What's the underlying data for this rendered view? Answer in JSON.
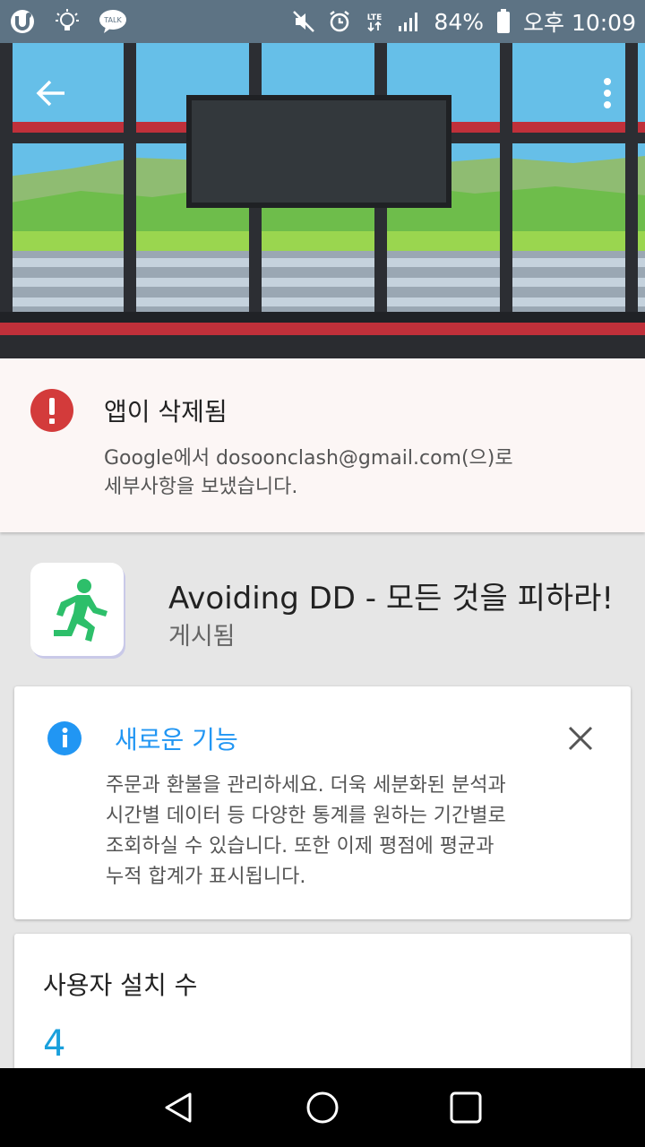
{
  "status_bar": {
    "battery": "84%",
    "time": "오후 10:09",
    "lte": "LTE",
    "kakao": "TALK",
    "icons": [
      "u-plus-icon",
      "lightbulb-icon",
      "kakaotalk-icon",
      "mute-icon",
      "alarm-icon",
      "lte-icon",
      "signal-icon",
      "battery-icon"
    ]
  },
  "header": {
    "back_icon": "arrow-back-icon",
    "menu_icon": "more-vert-icon"
  },
  "alert": {
    "title": "앱이 삭제됨",
    "body_line1": "Google에서 dosoonclash@gmail.com(으)로",
    "body_line2": "세부사항을 보냈습니다.",
    "icon": "error-icon",
    "color": "#d33b3b"
  },
  "app": {
    "name": "Avoiding DD - 모든 것을 피하라!",
    "status": "게시됨",
    "icon": "running-man-icon",
    "icon_color": "#2dbf6a"
  },
  "whats_new": {
    "title": "새로운 기능",
    "line1": "주문과 환불을 관리하세요. 더욱 세분화된 분석과",
    "line2": "시간별 데이터 등 다양한 통계를 원하는 기간별로",
    "line3": "조회하실 수 있습니다. 또한 이제 평점에 평균과",
    "line4": "누적 합계가 표시됩니다.",
    "accent": "#2196f3"
  },
  "installs": {
    "label": "사용자 설치 수",
    "value": "4",
    "color": "#1aa0dc"
  },
  "nav": {
    "icons": [
      "back-triangle-icon",
      "home-circle-icon",
      "recents-square-icon"
    ]
  }
}
